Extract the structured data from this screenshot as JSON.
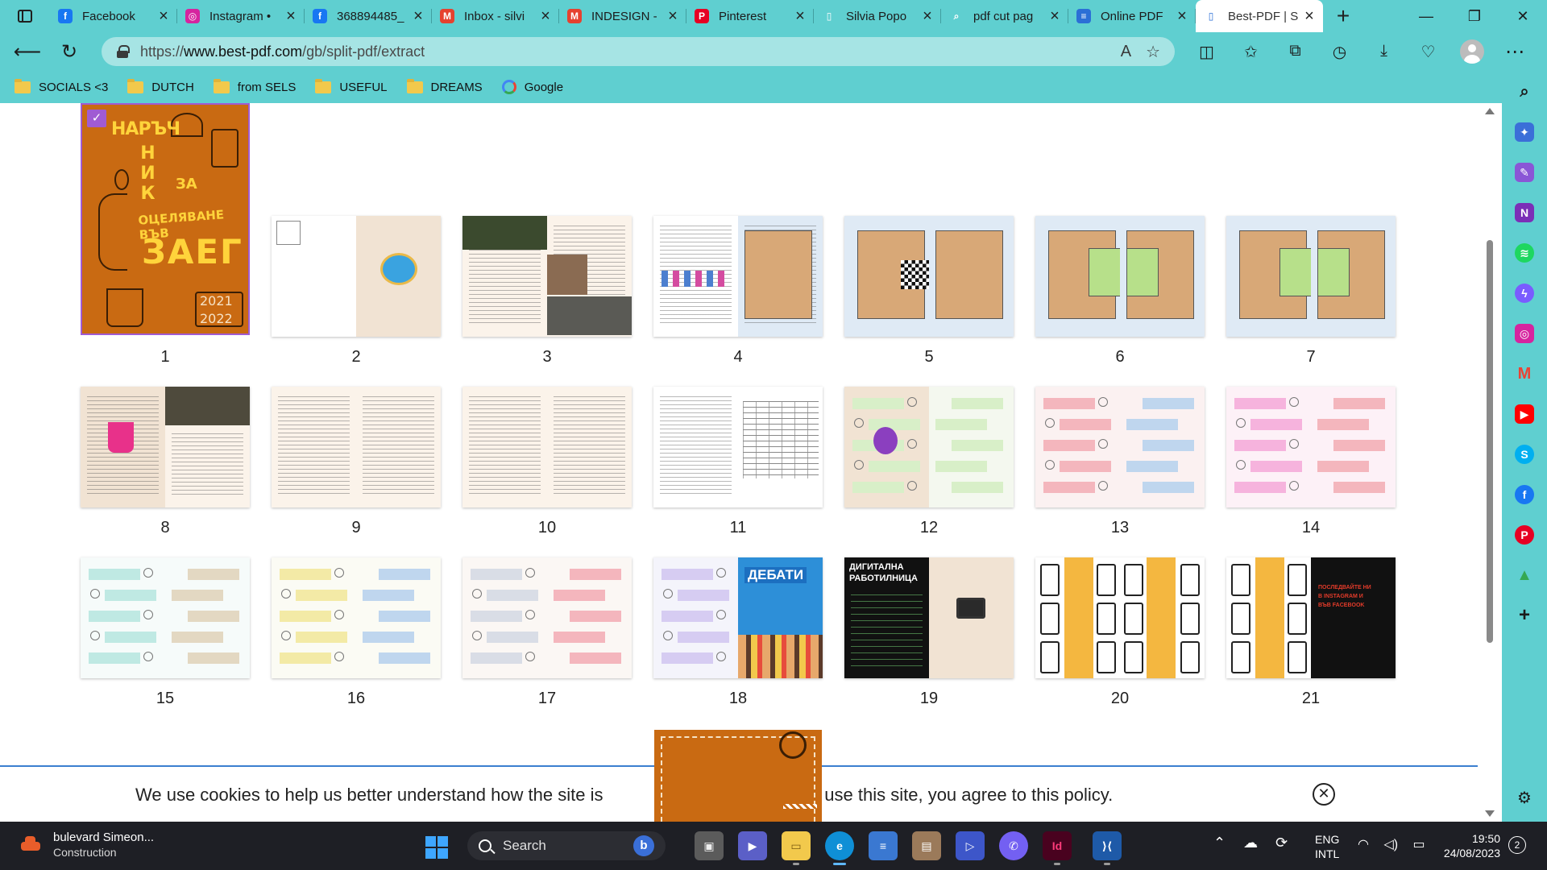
{
  "browser": {
    "tabs": [
      {
        "title": "Facebook",
        "icon": "facebook-icon",
        "color": "#1877f2",
        "glyph": "f"
      },
      {
        "title": "Instagram •",
        "icon": "instagram-icon",
        "color": "#d6249f",
        "glyph": "◎"
      },
      {
        "title": "368894485_",
        "icon": "facebook-icon",
        "color": "#1877f2",
        "glyph": "f"
      },
      {
        "title": "Inbox - silvi",
        "icon": "mail-icon",
        "color": "#e6412f",
        "glyph": "M"
      },
      {
        "title": "INDESIGN -",
        "icon": "mail-icon",
        "color": "#e6412f",
        "glyph": "M"
      },
      {
        "title": "Pinterest",
        "icon": "pinterest-icon",
        "color": "#e60023",
        "glyph": "P"
      },
      {
        "title": "Silvia Popo",
        "icon": "document-icon",
        "color": "#5fcfd0",
        "glyph": "▯"
      },
      {
        "title": "pdf cut pag",
        "icon": "search-icon",
        "color": "#5fcfd0",
        "glyph": "⌕"
      },
      {
        "title": "Online PDF",
        "icon": "online-pdf-icon",
        "color": "#2b6fd6",
        "glyph": "≡"
      },
      {
        "title": "Best-PDF | S",
        "icon": "best-pdf-icon",
        "color": "#ffffff",
        "glyph": "▯",
        "active": true
      }
    ],
    "window_controls": [
      "—",
      "❐",
      "✕"
    ],
    "new_tab": "+",
    "url_prefix": "https://",
    "url_domain": "www.best-pdf.com",
    "url_path": "/gb/split-pdf/extract",
    "read_aloud": "A",
    "favorites": [
      "SOCIALS <3",
      "DUTCH",
      "from SELS",
      "USEFUL",
      "DREAMS",
      "Google"
    ]
  },
  "pages": [
    {
      "n": "1"
    },
    {
      "n": "2"
    },
    {
      "n": "3"
    },
    {
      "n": "4"
    },
    {
      "n": "5"
    },
    {
      "n": "6"
    },
    {
      "n": "7"
    },
    {
      "n": "8"
    },
    {
      "n": "9"
    },
    {
      "n": "10"
    },
    {
      "n": "11"
    },
    {
      "n": "12"
    },
    {
      "n": "13"
    },
    {
      "n": "14"
    },
    {
      "n": "15"
    },
    {
      "n": "16"
    },
    {
      "n": "17"
    },
    {
      "n": "18"
    },
    {
      "n": "19"
    },
    {
      "n": "20"
    },
    {
      "n": "21"
    }
  ],
  "cover": {
    "line1": "НАРЪЧ",
    "line2": "НИК",
    "line3": "ЗА",
    "line4": "ОЦЕЛЯВАНЕ ВЪВ",
    "line5": "ЗАЕГ",
    "year1": "2021",
    "year2": "2022"
  },
  "thumb_texts": {
    "debates": "ДЕБАТИ",
    "workshop_1": "ДИГИТАЛНА",
    "workshop_2": "РАБОТИЛНИЦА",
    "social_1": "ПОСЛЕДВАЙТЕ НИ",
    "social_2": "В INSTAGRAM И",
    "social_3": "ВЪВ FACEBOOK"
  },
  "cookie": {
    "message_left": "We use cookies to help us better understand how the site is",
    "message_right": "g to use this site, you agree to this policy.",
    "close_glyph": "✕"
  },
  "taskbar": {
    "weather_title": "bulevard Simeon...",
    "weather_sub": "Construction",
    "search_placeholder": "Search",
    "lang_top": "ENG",
    "lang_bottom": "INTL",
    "time": "19:50",
    "date": "24/08/2023",
    "notifications": "2"
  }
}
